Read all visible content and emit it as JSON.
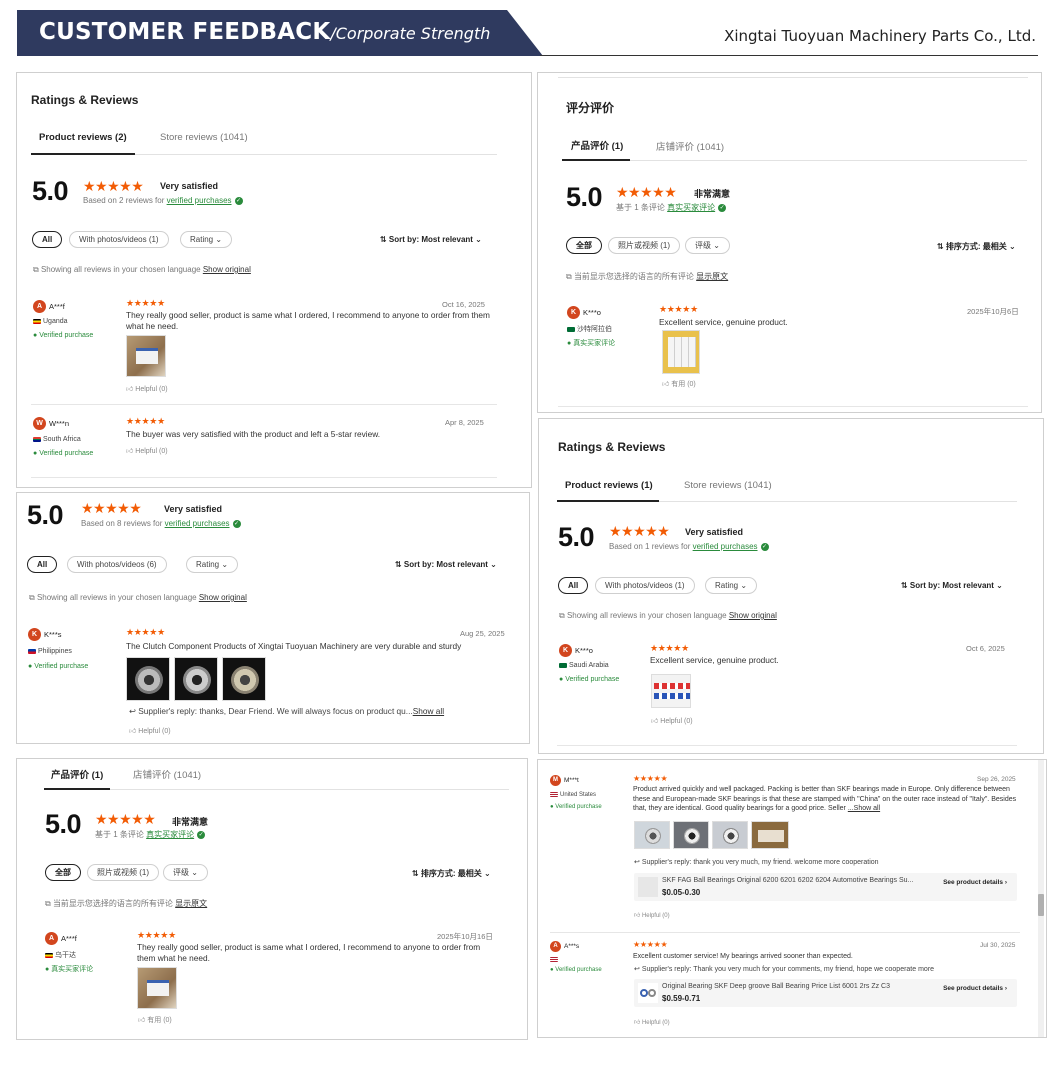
{
  "header": {
    "main_title": "CUSTOMER FEEDBACK",
    "subtitle": "/Corporate Strength",
    "company": "Xingtai Tuoyuan Machinery Parts Co., Ltd."
  },
  "colors": {
    "banner": "#2f3a5f",
    "star": "#f25c05",
    "verified": "#2a8b3c",
    "avatar": "#d2461e"
  },
  "panel1": {
    "title": "Ratings & Reviews",
    "tab_product": "Product reviews (2)",
    "tab_store": "Store reviews (1041)",
    "score": "5.0",
    "stars": "★★★★★",
    "satisfaction": "Very satisfied",
    "based_prefix": "Based on 2 reviews for",
    "verified_link": "verified purchases",
    "chip_all": "All",
    "chip_photos": "With photos/videos (1)",
    "chip_rating": "Rating ⌄",
    "sort": "⇅ Sort by: Most relevant ⌄",
    "showing": "Showing all reviews in your chosen language",
    "show_original": "Show original",
    "reviews": [
      {
        "initial": "A",
        "user": "A***f",
        "country": "Uganda",
        "verified": "Verified purchase",
        "date": "Oct 16, 2025",
        "text": "They really good seller, product is same what I ordered, I recommend to anyone to order from them what he need.",
        "helpful": "Helpful (0)"
      },
      {
        "initial": "W",
        "user": "W***n",
        "country": "South Africa",
        "verified": "Verified purchase",
        "date": "Apr 8, 2025",
        "text": "The buyer was very satisfied with the product and left a 5-star review.",
        "helpful": "Helpful (0)"
      }
    ]
  },
  "panel2": {
    "title": "评分评价",
    "tab_product": "产品评价 (1)",
    "tab_store": "店铺评价 (1041)",
    "score": "5.0",
    "stars": "★★★★★",
    "satisfaction": "非常满意",
    "based_prefix": "基于 1 条评论",
    "verified_link": "真实买家评论",
    "chip_all": "全部",
    "chip_photos": "照片或视频 (1)",
    "chip_rating": "评级 ⌄",
    "sort": "⇅ 排序方式: 最相关 ⌄",
    "showing": "当前显示您选择的语言的所有评论",
    "show_original": "显示原文",
    "review": {
      "initial": "K",
      "user": "K***o",
      "country": "沙特阿拉伯",
      "verified": "真实买家评论",
      "date": "2025年10月6日",
      "text": "Excellent service, genuine product.",
      "helpful": "有用 (0)"
    }
  },
  "panel3": {
    "score": "5.0",
    "stars": "★★★★★",
    "satisfaction": "Very satisfied",
    "based_prefix": "Based on 8 reviews for",
    "verified_link": "verified purchases",
    "chip_all": "All",
    "chip_photos": "With photos/videos (6)",
    "chip_rating": "Rating ⌄",
    "sort": "⇅ Sort by: Most relevant ⌄",
    "showing": "Showing all reviews in your chosen language",
    "show_original": "Show original",
    "review": {
      "initial": "K",
      "user": "K***s",
      "country": "Philippines",
      "verified": "Verified purchase",
      "date": "Aug 25, 2025",
      "text": "The Clutch Component Products of Xingtai Tuoyuan Machinery are very durable and sturdy",
      "reply": "Supplier's reply: thanks, Dear Friend. We will always focus on product qu...",
      "show_all": "Show all",
      "helpful": "Helpful (0)"
    }
  },
  "panel4": {
    "title": "Ratings & Reviews",
    "tab_product": "Product reviews (1)",
    "tab_store": "Store reviews (1041)",
    "score": "5.0",
    "stars": "★★★★★",
    "satisfaction": "Very satisfied",
    "based_prefix": "Based on 1 reviews for",
    "verified_link": "verified purchases",
    "chip_all": "All",
    "chip_photos": "With photos/videos (1)",
    "chip_rating": "Rating ⌄",
    "sort": "⇅ Sort by: Most relevant ⌄",
    "showing": "Showing all reviews in your chosen language",
    "show_original": "Show original",
    "review": {
      "initial": "K",
      "user": "K***o",
      "country": "Saudi Arabia",
      "verified": "Verified purchase",
      "date": "Oct 6, 2025",
      "text": "Excellent service, genuine product.",
      "helpful": "Helpful (0)"
    }
  },
  "panel5": {
    "tab_product": "产品评价 (1)",
    "tab_store": "店铺评价 (1041)",
    "score": "5.0",
    "stars": "★★★★★",
    "satisfaction": "非常满意",
    "based_prefix": "基于 1 条评论",
    "verified_link": "真实买家评论",
    "chip_all": "全部",
    "chip_photos": "照片或视频 (1)",
    "chip_rating": "评级 ⌄",
    "sort": "⇅ 排序方式: 最相关 ⌄",
    "showing": "当前显示您选择的语言的所有评论",
    "show_original": "显示原文",
    "review": {
      "initial": "A",
      "user": "A***f",
      "country": "乌干达",
      "verified": "真实买家评论",
      "date": "2025年10月16日",
      "text": "They really good seller, product is same what I ordered, I recommend to anyone to order from them what he need.",
      "helpful": "有用 (0)"
    }
  },
  "panel6": {
    "reviews": [
      {
        "initial": "M",
        "user": "M***t",
        "country": "United States",
        "verified": "Verified purchase",
        "date": "Sep 26, 2025",
        "text": "Product arrived quickly and well packaged. Packing is better than SKF bearings made in Europe. Only difference between these and European-made SKF bearings is that these are stamped with \"China\" on the outer race instead of \"Italy\". Besides that, they are identical. Good quality bearings for a good price. Seller",
        "show_all": "...Show all",
        "reply": "Supplier's reply: thank you very much, my friend. welcome more cooperation",
        "product_name": "SKF FAG Ball Bearings Original 6200 6201 6202 6204 Automotive Bearings Su...",
        "product_price": "$0.05-0.30",
        "details": "See product details ›",
        "helpful": "Helpful (0)"
      },
      {
        "initial": "A",
        "user": "A***s",
        "country": "",
        "verified": "Verified purchase",
        "date": "Jul 30, 2025",
        "text": "Excellent customer service! My bearings arrived sooner than expected.",
        "reply": "Supplier's reply: Thank you very much for your comments, my friend, hope we cooperate more",
        "product_name": "Original Bearing SKF Deep groove Ball Bearing Price List 6001 2rs Zz C3",
        "product_price": "$0.59-0.71",
        "details": "See product details ›",
        "helpful": "Helpful (0)"
      }
    ]
  }
}
